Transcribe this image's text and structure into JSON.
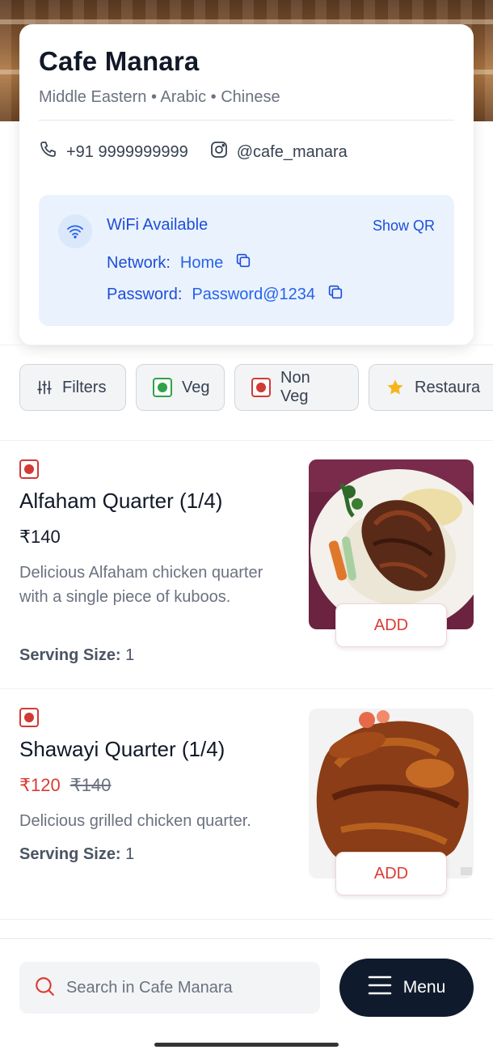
{
  "header": {
    "cafe_name": "Cafe Manara",
    "cuisines": "Middle Eastern • Arabic • Chinese"
  },
  "contact": {
    "phone": "+91 9999999999",
    "instagram": "@cafe_manara"
  },
  "wifi": {
    "title": "WiFi Available",
    "show_qr": "Show QR",
    "network_label": "Network:",
    "network_value": "Home",
    "password_label": "Password:",
    "password_value": "Password@1234"
  },
  "filters": [
    {
      "label": "Filters",
      "icon": "sliders-icon"
    },
    {
      "label": "Veg",
      "icon": "veg-icon"
    },
    {
      "label": "Non Veg",
      "icon": "non-veg-icon"
    },
    {
      "label": "Restaura",
      "icon": "star-icon"
    }
  ],
  "items": [
    {
      "name": "Alfaham Quarter (1/4)",
      "price": "₹140",
      "description": "Delicious Alfaham chicken quarter with a single piece of kuboos.",
      "serving_label": "Serving Size:",
      "serving_value": "1",
      "add_label": "ADD",
      "type": "non-veg"
    },
    {
      "name": "Shawayi Quarter (1/4)",
      "price": "₹120",
      "original_price": "₹140",
      "description": "Delicious grilled chicken quarter.",
      "serving_label": "Serving Size:",
      "serving_value": "1",
      "add_label": "ADD",
      "type": "non-veg"
    }
  ],
  "bottom": {
    "search_placeholder": "Search in Cafe Manara",
    "menu_label": "Menu"
  },
  "colors": {
    "accent_blue": "#1d4ed8",
    "sale_red": "#dc3b33",
    "veg_green": "#2fa34a",
    "menu_button": "#0f1b2d"
  }
}
